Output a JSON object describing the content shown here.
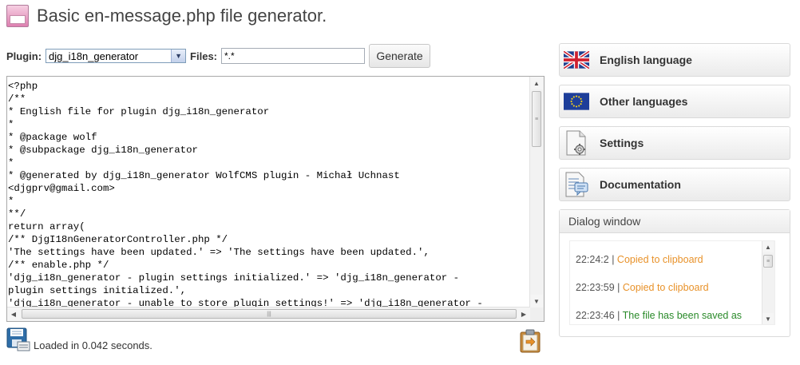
{
  "header": {
    "title": "Basic en-message.php file generator."
  },
  "controls": {
    "plugin_label": "Plugin:",
    "plugin_selected": "djg_i18n_generator",
    "files_label": "Files:",
    "files_value": "*.*",
    "generate_label": "Generate"
  },
  "editor": {
    "code": "<?php\n/**\n* English file for plugin djg_i18n_generator\n*\n* @package wolf\n* @subpackage djg_i18n_generator\n*\n* @generated by djg_i18n_generator WolfCMS plugin - Michał Uchnast\n<djgprv@gmail.com>\n*\n**/\nreturn array(\n/** DjgI18nGeneratorController.php */\n'The settings have been updated.' => 'The settings have been updated.',\n/** enable.php */\n'djg_i18n_generator - plugin settings initialized.' => 'djg_i18n_generator -\nplugin settings initialized.',\n'djg_i18n_generator - unable to store plugin settings!' => 'djg_i18n_generator -"
  },
  "status": {
    "text": "Loaded in 0.042 seconds."
  },
  "sidebar": {
    "items": [
      {
        "label": "English language",
        "icon": "uk-flag-icon"
      },
      {
        "label": "Other languages",
        "icon": "eu-flag-icon"
      },
      {
        "label": "Settings",
        "icon": "settings-document-icon"
      },
      {
        "label": "Documentation",
        "icon": "documentation-icon"
      }
    ]
  },
  "dialog": {
    "title": "Dialog window",
    "entries": [
      {
        "time": "22:24:2",
        "separator": " | ",
        "message": "Copied to clipboard",
        "color": "#e8922a"
      },
      {
        "time": "22:23:59",
        "separator": " | ",
        "message": "Copied to clipboard",
        "color": "#e8922a"
      },
      {
        "time": "22:23:46",
        "separator": " | ",
        "message": "The file has been saved as",
        "color": "#2a8a2a"
      }
    ]
  },
  "colors": {
    "accent_orange": "#e8922a",
    "accent_green": "#2a8a2a"
  }
}
